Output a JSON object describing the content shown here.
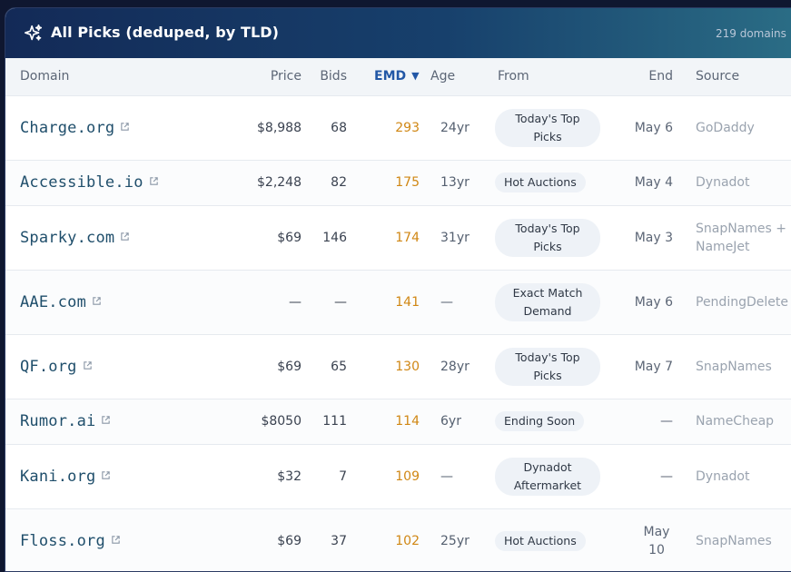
{
  "header": {
    "title": "All Picks (deduped, by TLD)",
    "count": "219 domains"
  },
  "columns": {
    "domain": "Domain",
    "price": "Price",
    "bids": "Bids",
    "emd": "EMD",
    "emd_sort_icon": "triangle-down-icon",
    "age": "Age",
    "from": "From",
    "end": "End",
    "source": "Source"
  },
  "colors": {
    "header_start": "#132a57",
    "header_end": "#2b6e86",
    "emd_value": "#d08714",
    "domain_text": "#1f4e6b",
    "sorted_column": "#2257a6"
  },
  "rows": [
    {
      "domain": "Charge.org",
      "price": "$8,988",
      "bids": "68",
      "emd": "293",
      "age": "24yr",
      "from": "Today's Top Picks",
      "end": "May 6",
      "source": "GoDaddy"
    },
    {
      "domain": "Accessible.io",
      "price": "$2,248",
      "bids": "82",
      "emd": "175",
      "age": "13yr",
      "from": "Hot Auctions",
      "end": "May 4",
      "source": "Dynadot"
    },
    {
      "domain": "Sparky.com",
      "price": "$69",
      "bids": "146",
      "emd": "174",
      "age": "31yr",
      "from": "Today's Top Picks",
      "end": "May 3",
      "source": "SnapNames + NameJet"
    },
    {
      "domain": "AAE.com",
      "price": "—",
      "bids": "—",
      "emd": "141",
      "age": "—",
      "from": "Exact Match Demand",
      "end": "May 6",
      "source": "PendingDelete"
    },
    {
      "domain": "QF.org",
      "price": "$69",
      "bids": "65",
      "emd": "130",
      "age": "28yr",
      "from": "Today's Top Picks",
      "end": "May 7",
      "source": "SnapNames"
    },
    {
      "domain": "Rumor.ai",
      "price": "$8050",
      "bids": "111",
      "emd": "114",
      "age": "6yr",
      "from": "Ending Soon",
      "end": "—",
      "source": "NameCheap"
    },
    {
      "domain": "Kani.org",
      "price": "$32",
      "bids": "7",
      "emd": "109",
      "age": "—",
      "from": "Dynadot Aftermarket",
      "end": "—",
      "source": "Dynadot"
    },
    {
      "domain": "Floss.org",
      "price": "$69",
      "bids": "37",
      "emd": "102",
      "age": "25yr",
      "from": "Hot Auctions",
      "end": "May 10",
      "source": "SnapNames"
    }
  ]
}
